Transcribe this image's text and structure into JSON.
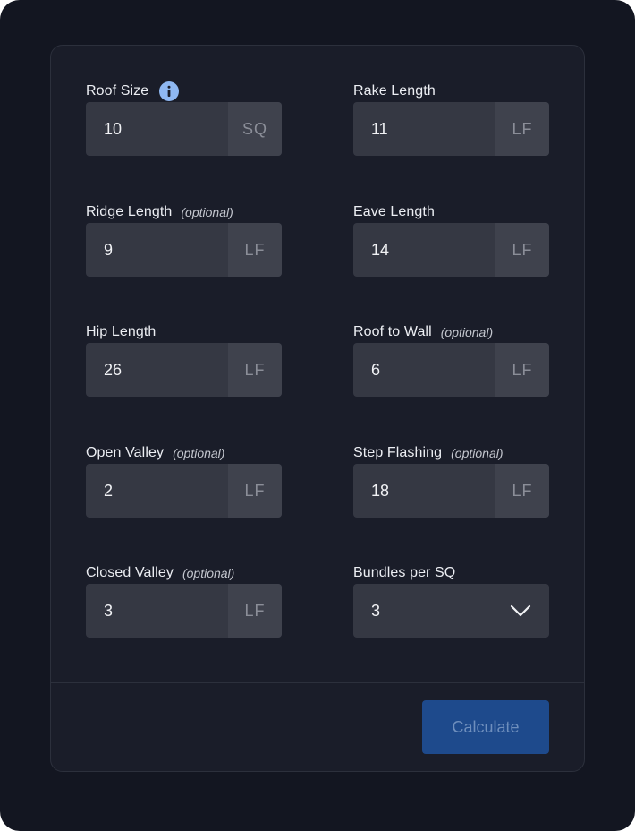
{
  "fields": [
    {
      "label": "Roof Size",
      "optional": "",
      "value": "10",
      "unit": "SQ",
      "has_info": true
    },
    {
      "label": "Rake Length",
      "optional": "",
      "value": "11",
      "unit": "LF"
    },
    {
      "label": "Ridge Length",
      "optional": "(optional)",
      "value": "9",
      "unit": "LF"
    },
    {
      "label": "Eave Length",
      "optional": "",
      "value": "14",
      "unit": "LF"
    },
    {
      "label": "Hip Length",
      "optional": "",
      "value": "26",
      "unit": "LF"
    },
    {
      "label": "Roof to Wall",
      "optional": "(optional)",
      "value": "6",
      "unit": "LF"
    },
    {
      "label": "Open Valley",
      "optional": "(optional)",
      "value": "2",
      "unit": "LF"
    },
    {
      "label": "Step Flashing",
      "optional": "(optional)",
      "value": "18",
      "unit": "LF"
    },
    {
      "label": "Closed Valley",
      "optional": "(optional)",
      "value": "3",
      "unit": "LF"
    },
    {
      "label": "Bundles per SQ",
      "optional": "",
      "value": "3",
      "unit": "",
      "type": "select",
      "icon": "chevron-down-icon"
    }
  ],
  "info_icon": {
    "glyph": "i",
    "name": "info-icon",
    "color": "#8fb8f2"
  },
  "calculate_button": {
    "label": "Calculate"
  },
  "colors": {
    "background": "#131621",
    "card": "#1a1d29",
    "input": "#353843",
    "unit": "#3f424d",
    "button": "#1e4a8c",
    "button_text": "#6f8fbd",
    "info": "#8fb8f2"
  }
}
